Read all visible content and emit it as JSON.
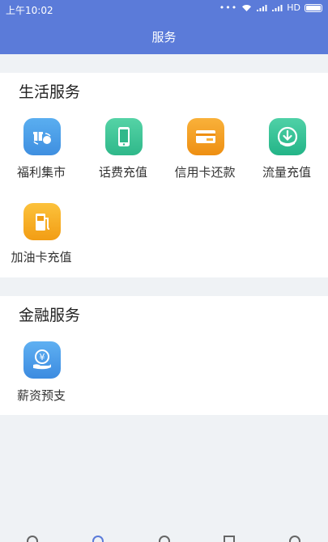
{
  "status": {
    "time": "上午10:02",
    "network": "HD"
  },
  "header": {
    "title": "服务"
  },
  "life": {
    "title": "生活服务",
    "items": [
      {
        "label": "福利集市",
        "icon": "gift-bag-icon"
      },
      {
        "label": "话费充值",
        "icon": "phone-icon"
      },
      {
        "label": "信用卡还款",
        "icon": "card-icon"
      },
      {
        "label": "流量充值",
        "icon": "download-icon"
      },
      {
        "label": "加油卡充值",
        "icon": "fuel-pump-icon"
      }
    ]
  },
  "finance": {
    "title": "金融服务",
    "items": [
      {
        "label": "薪资预支",
        "icon": "yen-hand-icon"
      }
    ]
  },
  "colors": {
    "accent": "#5b7bd9",
    "background": "#eff2f5"
  }
}
